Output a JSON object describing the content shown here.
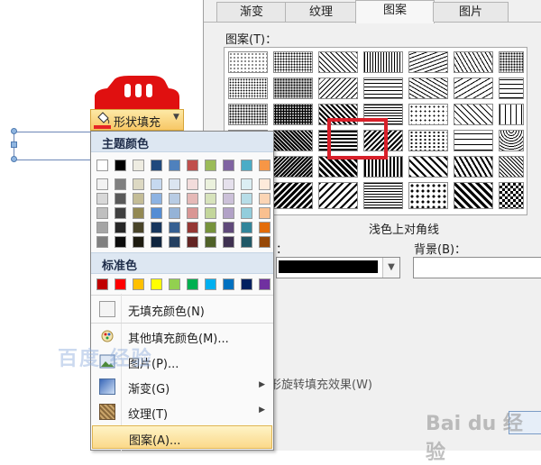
{
  "dialog": {
    "tabs": [
      {
        "label": "渐变",
        "active": false
      },
      {
        "label": "纹理",
        "active": false
      },
      {
        "label": "图案",
        "active": true
      },
      {
        "label": "图片",
        "active": false
      }
    ],
    "pattern_label": "图案(T)：",
    "selected_pattern": "浅色上对角线",
    "foreground_label": "：",
    "background_label": "背景(B)：",
    "foreground_color": "#000000",
    "background_color": "#ffffff",
    "rotate_option": "形旋转填充效果(W)"
  },
  "fill_button": {
    "label": "形状填充",
    "icon": "paint-bucket-icon",
    "accent": "#e62424"
  },
  "menu": {
    "theme_colors_header": "主题颜色",
    "standard_colors_header": "标准色",
    "theme_colors": [
      "#ffffff",
      "#000000",
      "#eeece1",
      "#1f497d",
      "#4f81bd",
      "#c0504d",
      "#9bbb59",
      "#8064a2",
      "#4bacc6",
      "#f79646"
    ],
    "theme_tints": [
      [
        "#f2f2f2",
        "#7f7f7f",
        "#ddd9c3",
        "#c6d9f0",
        "#dbe5f1",
        "#f2dcdb",
        "#ebf1dd",
        "#e5e0ec",
        "#dbeef3",
        "#fdeada"
      ],
      [
        "#d8d8d8",
        "#595959",
        "#c4bd97",
        "#8db3e2",
        "#b8cce4",
        "#e5b9b7",
        "#d7e3bc",
        "#ccc1d9",
        "#b7dde8",
        "#fbd5b5"
      ],
      [
        "#bfbfbf",
        "#3f3f3f",
        "#938953",
        "#548dd4",
        "#95b3d7",
        "#d99694",
        "#c3d69b",
        "#b2a2c7",
        "#92cddc",
        "#fac08f"
      ],
      [
        "#a5a5a5",
        "#262626",
        "#494429",
        "#17365d",
        "#366092",
        "#953734",
        "#76923c",
        "#5f497a",
        "#31859b",
        "#e36c09"
      ],
      [
        "#7f7f7f",
        "#0c0c0c",
        "#1d1b10",
        "#0f243e",
        "#244061",
        "#632423",
        "#4f6128",
        "#3f3151",
        "#205867",
        "#974806"
      ]
    ],
    "standard_colors": [
      "#c00000",
      "#ff0000",
      "#ffc000",
      "#ffff00",
      "#92d050",
      "#00b050",
      "#00b0f0",
      "#0070c0",
      "#002060",
      "#7030a0"
    ],
    "items": [
      {
        "label": "无填充颜色(N)",
        "icon": "no-fill-icon",
        "submenu": false
      },
      {
        "label": "其他填充颜色(M)...",
        "icon": "color-palette-icon",
        "submenu": false
      },
      {
        "label": "图片(P)...",
        "icon": "picture-icon",
        "submenu": false
      },
      {
        "label": "渐变(G)",
        "icon": "gradient-icon",
        "submenu": true
      },
      {
        "label": "纹理(T)",
        "icon": "texture-icon",
        "submenu": true
      },
      {
        "label": "图案(A)...",
        "icon": "",
        "submenu": false
      }
    ]
  },
  "watermark": {
    "left": "百度 经验",
    "right": "Bai du 经验"
  }
}
